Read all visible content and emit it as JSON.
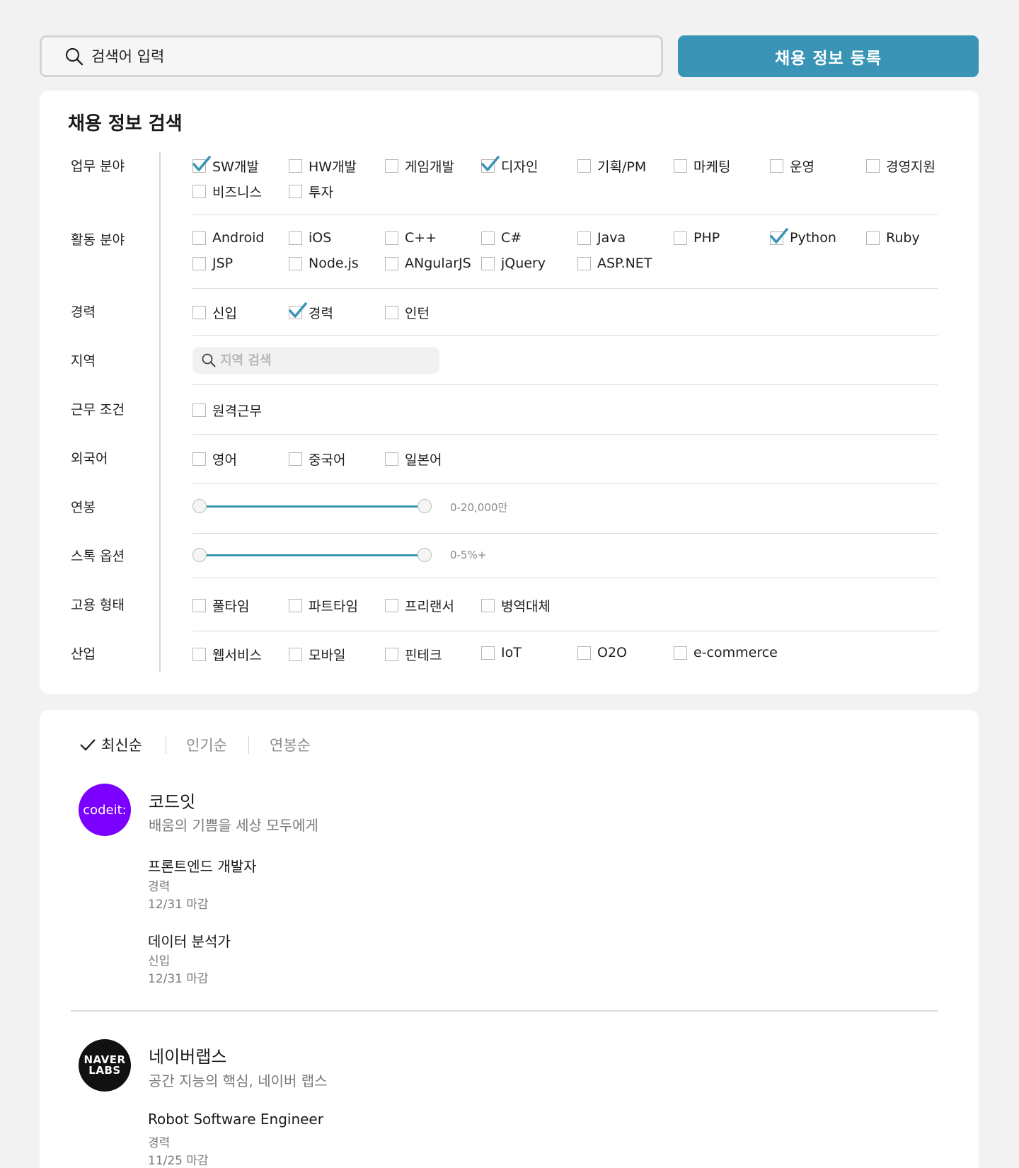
{
  "search": {
    "placeholder": "검색어 입력"
  },
  "register_label": "채용 정보 등록",
  "filter": {
    "title": "채용 정보 검색",
    "job_field": {
      "label": "업무 분야",
      "options": [
        {
          "label": "SW개발",
          "checked": true
        },
        {
          "label": "HW개발",
          "checked": false
        },
        {
          "label": "게임개발",
          "checked": false
        },
        {
          "label": "디자인",
          "checked": true
        },
        {
          "label": "기획/PM",
          "checked": false
        },
        {
          "label": "마케팅",
          "checked": false
        },
        {
          "label": "운영",
          "checked": false
        },
        {
          "label": "경영지원",
          "checked": false
        },
        {
          "label": "비즈니스",
          "checked": false
        },
        {
          "label": "투자",
          "checked": false
        }
      ]
    },
    "tech_field": {
      "label": "활동 분야",
      "options": [
        {
          "label": "Android",
          "checked": false
        },
        {
          "label": "iOS",
          "checked": false
        },
        {
          "label": "C++",
          "checked": false
        },
        {
          "label": "C#",
          "checked": false
        },
        {
          "label": "Java",
          "checked": false
        },
        {
          "label": "PHP",
          "checked": false
        },
        {
          "label": "Python",
          "checked": true
        },
        {
          "label": "Ruby",
          "checked": false
        },
        {
          "label": "JSP",
          "checked": false
        },
        {
          "label": "Node.js",
          "checked": false
        },
        {
          "label": "ANgularJS",
          "checked": false
        },
        {
          "label": "jQuery",
          "checked": false
        },
        {
          "label": "ASP.NET",
          "checked": false
        }
      ]
    },
    "career": {
      "label": "경력",
      "options": [
        {
          "label": "신입",
          "checked": false
        },
        {
          "label": "경력",
          "checked": true
        },
        {
          "label": "인턴",
          "checked": false
        }
      ]
    },
    "region": {
      "label": "지역",
      "placeholder": "지역 검색"
    },
    "work_condition": {
      "label": "근무 조건",
      "options": [
        {
          "label": "원격근무",
          "checked": false
        }
      ]
    },
    "language": {
      "label": "외국어",
      "options": [
        {
          "label": "영어",
          "checked": false
        },
        {
          "label": "중국어",
          "checked": false
        },
        {
          "label": "일본어",
          "checked": false
        }
      ]
    },
    "salary": {
      "label": "연봉",
      "value": "0-20,000만"
    },
    "stock": {
      "label": "스톡 옵션",
      "value": "0-5%+"
    },
    "employment": {
      "label": "고용 형태",
      "options": [
        {
          "label": "풀타임",
          "checked": false
        },
        {
          "label": "파트타임",
          "checked": false
        },
        {
          "label": "프리랜서",
          "checked": false
        },
        {
          "label": "병역대체",
          "checked": false
        }
      ]
    },
    "industry": {
      "label": "산업",
      "options": [
        {
          "label": "웹서비스",
          "checked": false
        },
        {
          "label": "모바일",
          "checked": false
        },
        {
          "label": "핀테크",
          "checked": false
        },
        {
          "label": "IoT",
          "checked": false
        },
        {
          "label": "O2O",
          "checked": false
        },
        {
          "label": "e-commerce",
          "checked": false
        }
      ]
    }
  },
  "sort": {
    "options": [
      {
        "label": "최신순",
        "active": true
      },
      {
        "label": "인기순",
        "active": false
      },
      {
        "label": "연봉순",
        "active": false
      }
    ]
  },
  "companies": [
    {
      "logo_text": "codeit:",
      "name": "코드잇",
      "desc": "배움의 기쁨을 세상 모두에게",
      "jobs": [
        {
          "title": "프론트엔드 개발자",
          "career": "경력",
          "deadline": "12/31 마감"
        },
        {
          "title": "데이터 분석가",
          "career": "신입",
          "deadline": "12/31 마감"
        }
      ]
    },
    {
      "logo_text_1": "NAVER",
      "logo_text_2": "LABS",
      "name": "네이버랩스",
      "desc": "공간 지능의 핵심, 네이버 랩스",
      "jobs": [
        {
          "title": "Robot Software Engineer",
          "career": "경력",
          "deadline": "11/25 마감"
        }
      ]
    }
  ],
  "colors": {
    "accent": "#3a94b5",
    "codeit_purple": "#7b00ff",
    "naver_black": "#111111"
  }
}
